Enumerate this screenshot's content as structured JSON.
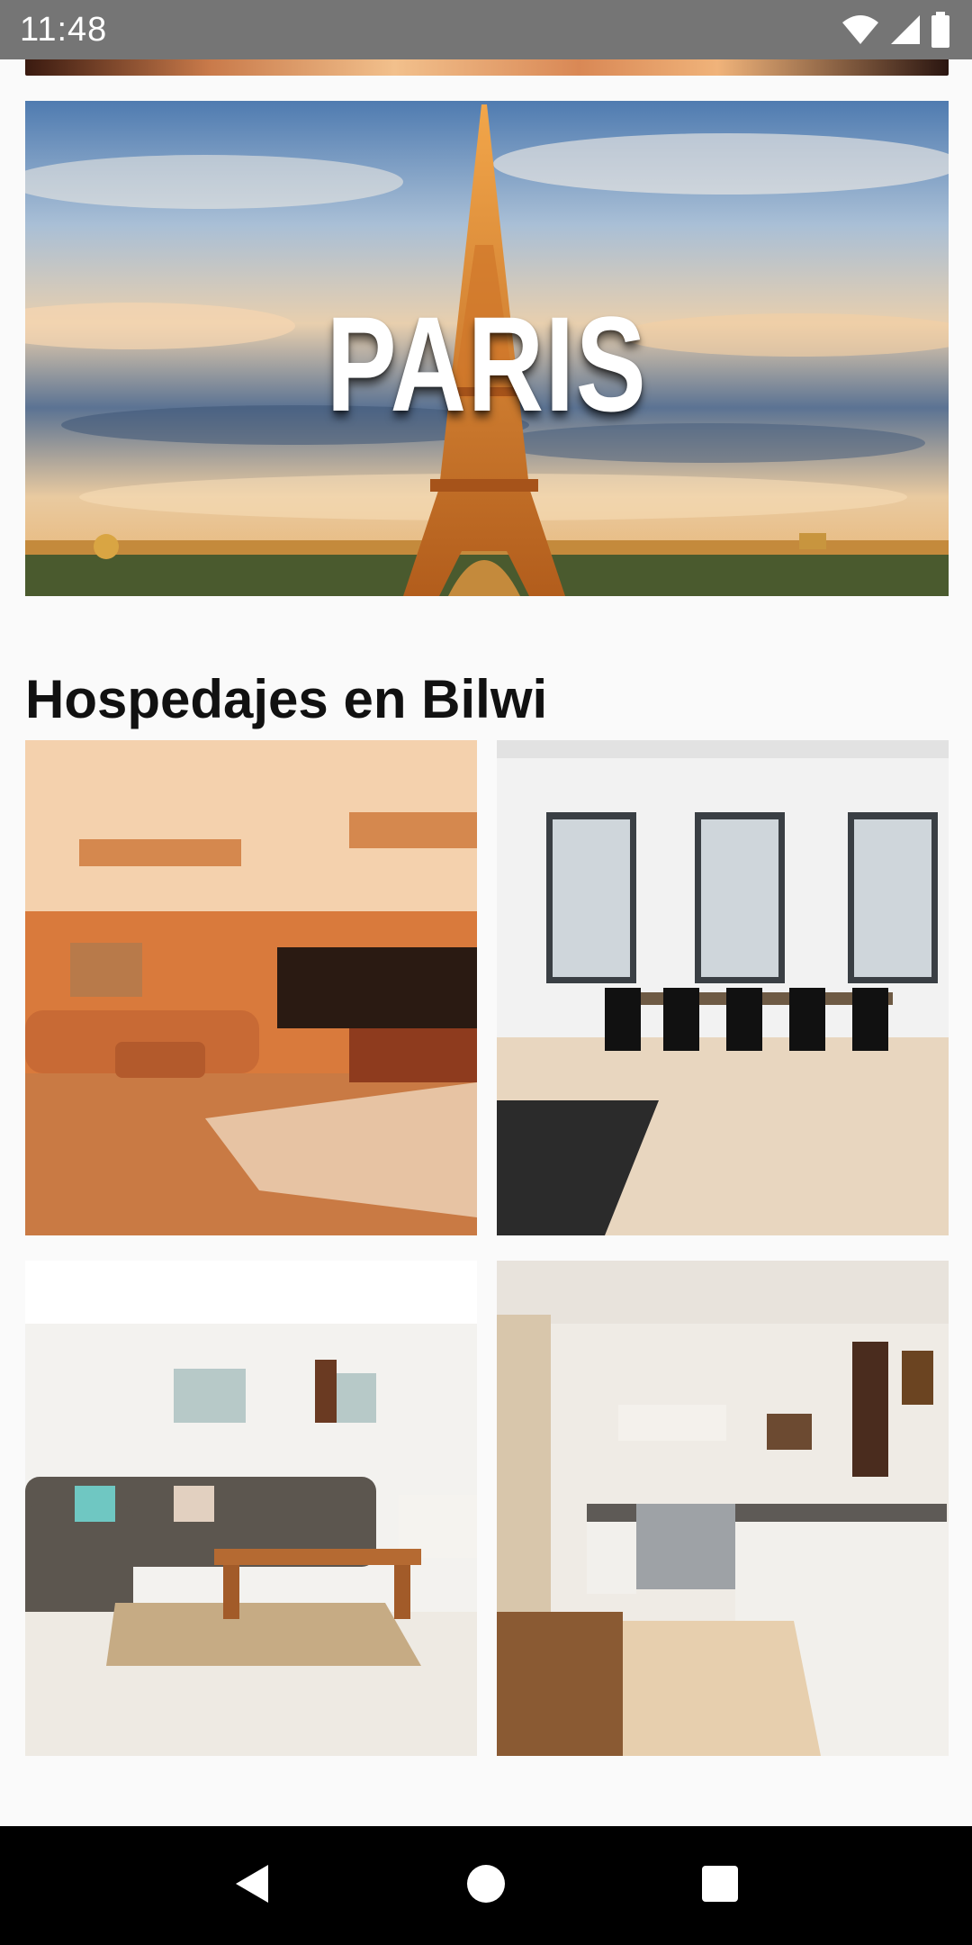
{
  "status_bar": {
    "time": "11:48",
    "icons": [
      "wifi-icon",
      "signal-icon",
      "battery-icon"
    ]
  },
  "banner": {
    "title": "PARIS",
    "image": "eiffel-tower-photo"
  },
  "section": {
    "title": "Hospedajes en Bilwi"
  },
  "listings": [
    {
      "image": "living-room-billiards-photo"
    },
    {
      "image": "dining-room-windows-photo"
    },
    {
      "image": "living-room-sofa-photo"
    },
    {
      "image": "kitchen-photo"
    }
  ],
  "nav_bar": {
    "buttons": [
      "back-icon",
      "home-icon",
      "recents-icon"
    ]
  },
  "colors": {
    "status_bar": "#757575",
    "background": "#fafafa",
    "nav_bar": "#000000",
    "title_text": "#111111"
  }
}
